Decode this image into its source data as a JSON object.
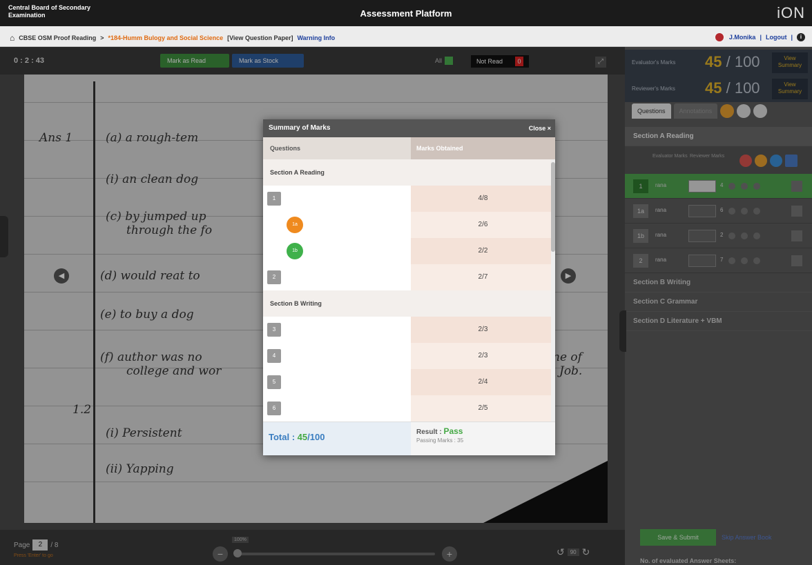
{
  "header": {
    "board": "Central Board of Secondary Examination",
    "platform": "Assessment Platform",
    "logo": "iON"
  },
  "breadcrumb": {
    "root": "CBSE OSM Proof Reading",
    "separator": ">",
    "subject": "*184-Humm Bulogy and Social Science",
    "view_paper": "[View Question Paper]",
    "warning": "Warning Info"
  },
  "user": {
    "name": "J.Monika",
    "sep": "|",
    "logout": "Logout",
    "sep2": "|"
  },
  "toolbar": {
    "timer": "0 : 2 : 43",
    "mark_read": "Mark as Read",
    "mark_stock": "Mark as Stock",
    "all_label": "All",
    "not_read": "Not Read",
    "not_read_count": "0"
  },
  "bottom": {
    "page_label": "Page",
    "page_value": "2",
    "page_total": "/ 8",
    "page_hint": "Press 'Enter' to go",
    "zoom_value": "100%",
    "rotate_value": "90"
  },
  "handwriting": {
    "lines": [
      "Ans 1",
      "(a) a rough-tem",
      "(i) an clean dog",
      "(c) by jumped up",
      "through the fo",
      "(d) would reat to",
      "(e) to buy a dog",
      "(f) author was no",
      "college and wor",
      "1.2",
      "(i) Persistent",
      "(ii) Yapping",
      "ne of",
      "Job."
    ]
  },
  "right_panel": {
    "evaluator_label": "Evaluator's Marks",
    "evaluator_marks": "45",
    "evaluator_total": "/ 100",
    "reviewer_label": "Reviewer's Marks",
    "reviewer_marks": "45",
    "reviewer_total": "/ 100",
    "view_summary": "View Summary",
    "tabs": [
      "Questions",
      "Annotations"
    ],
    "sections": [
      {
        "name": "Section A Reading"
      },
      {
        "name": "Section B Writing"
      },
      {
        "name": "Section C Grammar"
      },
      {
        "name": "Section D Literature + VBM"
      }
    ],
    "col_evaluator": "Evaluator Marks",
    "col_reviewer": "Reviewer Marks",
    "qrows": [
      {
        "n": "1",
        "t": "rana",
        "v": "4"
      },
      {
        "n": "1a",
        "t": "rana",
        "v": "6"
      },
      {
        "n": "1b",
        "t": "rana",
        "v": "2"
      },
      {
        "n": "2",
        "t": "rana",
        "v": "7"
      }
    ],
    "save_submit": "Save & Submit",
    "skip": "Skip Answer Book",
    "evaluated": "No. of evaluated Answer Sheets:"
  },
  "modal": {
    "title": "Summary of Marks",
    "close": "Close ×",
    "col_questions": "Questions",
    "col_marks": "Marks Obtained",
    "rows": [
      {
        "kind": "section",
        "label": "Section A Reading"
      },
      {
        "kind": "q",
        "q": "1",
        "marks": "4/8"
      },
      {
        "kind": "sub",
        "q": "1a",
        "color": "#ef8a1f",
        "marks": "2/6"
      },
      {
        "kind": "sub",
        "q": "1b",
        "color": "#3fb14b",
        "marks": "2/2"
      },
      {
        "kind": "q",
        "q": "2",
        "marks": "2/7"
      },
      {
        "kind": "section",
        "label": "Section B Writing"
      },
      {
        "kind": "q",
        "q": "3",
        "marks": "2/3"
      },
      {
        "kind": "q",
        "q": "4",
        "marks": "2/3"
      },
      {
        "kind": "q",
        "q": "5",
        "marks": "2/4"
      },
      {
        "kind": "q",
        "q": "6",
        "marks": "2/5"
      }
    ],
    "total_label": "Total :",
    "total_value": "45",
    "total_max": "/100",
    "result_label": "Result :",
    "result_value": "Pass",
    "passing_label": "Passing Marks : 35"
  },
  "colors": {
    "accent_green": "#4ea34e",
    "accent_blue": "#2f5d9c",
    "marks_gold": "#e3b42a",
    "orange": "#ef8a1f",
    "green_badge": "#3fb14b"
  }
}
